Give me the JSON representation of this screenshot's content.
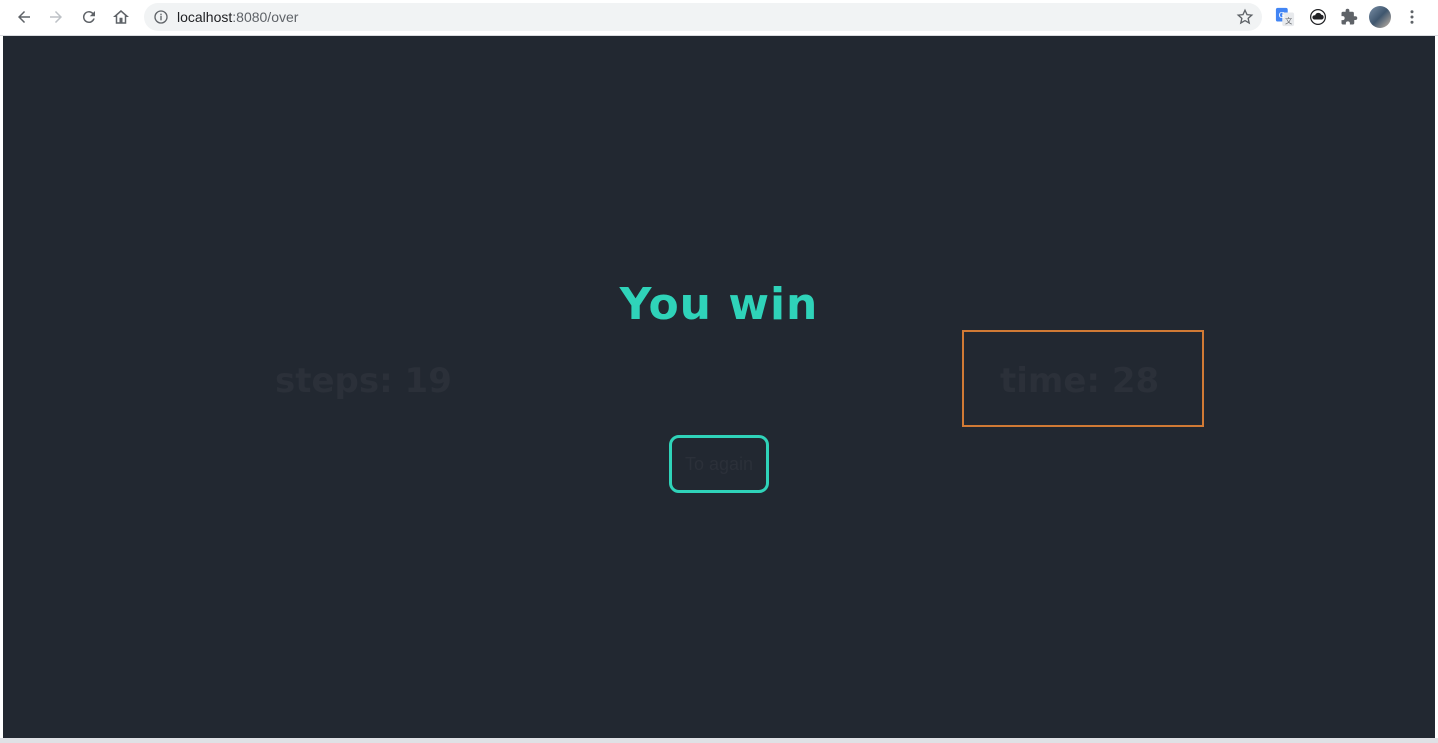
{
  "browser": {
    "url_host": "localhost",
    "url_path": ":8080/over",
    "icons": {
      "back": "back-arrow-icon",
      "forward": "forward-arrow-icon",
      "reload": "reload-icon",
      "home": "home-icon",
      "info": "info-icon",
      "bookmark": "star-icon",
      "translate": "translate-icon",
      "cloud": "cloud-icon",
      "extensions": "puzzle-icon",
      "profile": "avatar",
      "menu": "kebab-menu-icon"
    }
  },
  "game": {
    "title": "You win",
    "steps": "steps: 19",
    "time": "time: 28",
    "again_button": "To again"
  },
  "colors": {
    "background": "#222831",
    "accent": "#2fd3b9",
    "dim_text": "#2b3039",
    "highlight_border": "#d17a35"
  }
}
